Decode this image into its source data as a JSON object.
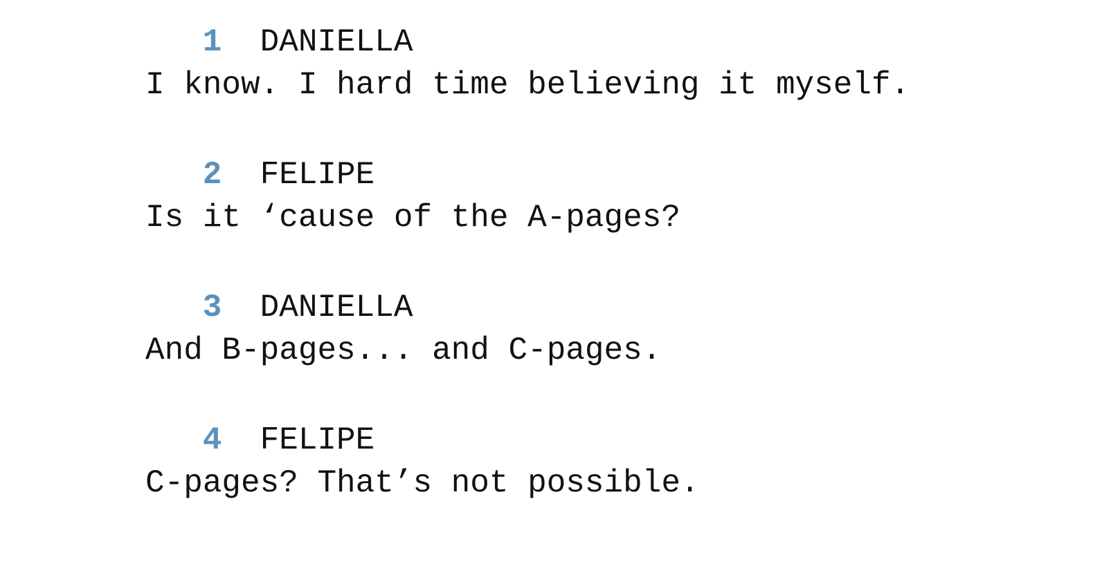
{
  "document": {
    "type": "screenplay-dialogue-transcript",
    "background_color": "#ffffff",
    "text_color": "#111111",
    "cue_number_color": "#5b92bd"
  },
  "dialogue": [
    {
      "number": "1",
      "speaker": "DANIELLA",
      "text": "I know. I hard time believing it myself."
    },
    {
      "number": "2",
      "speaker": "FELIPE",
      "text": "Is it ‘cause of the A-pages?"
    },
    {
      "number": "3",
      "speaker": "DANIELLA",
      "text": "And B-pages... and C-pages."
    },
    {
      "number": "4",
      "speaker": "FELIPE",
      "text": "C-pages? That’s not possible."
    }
  ]
}
